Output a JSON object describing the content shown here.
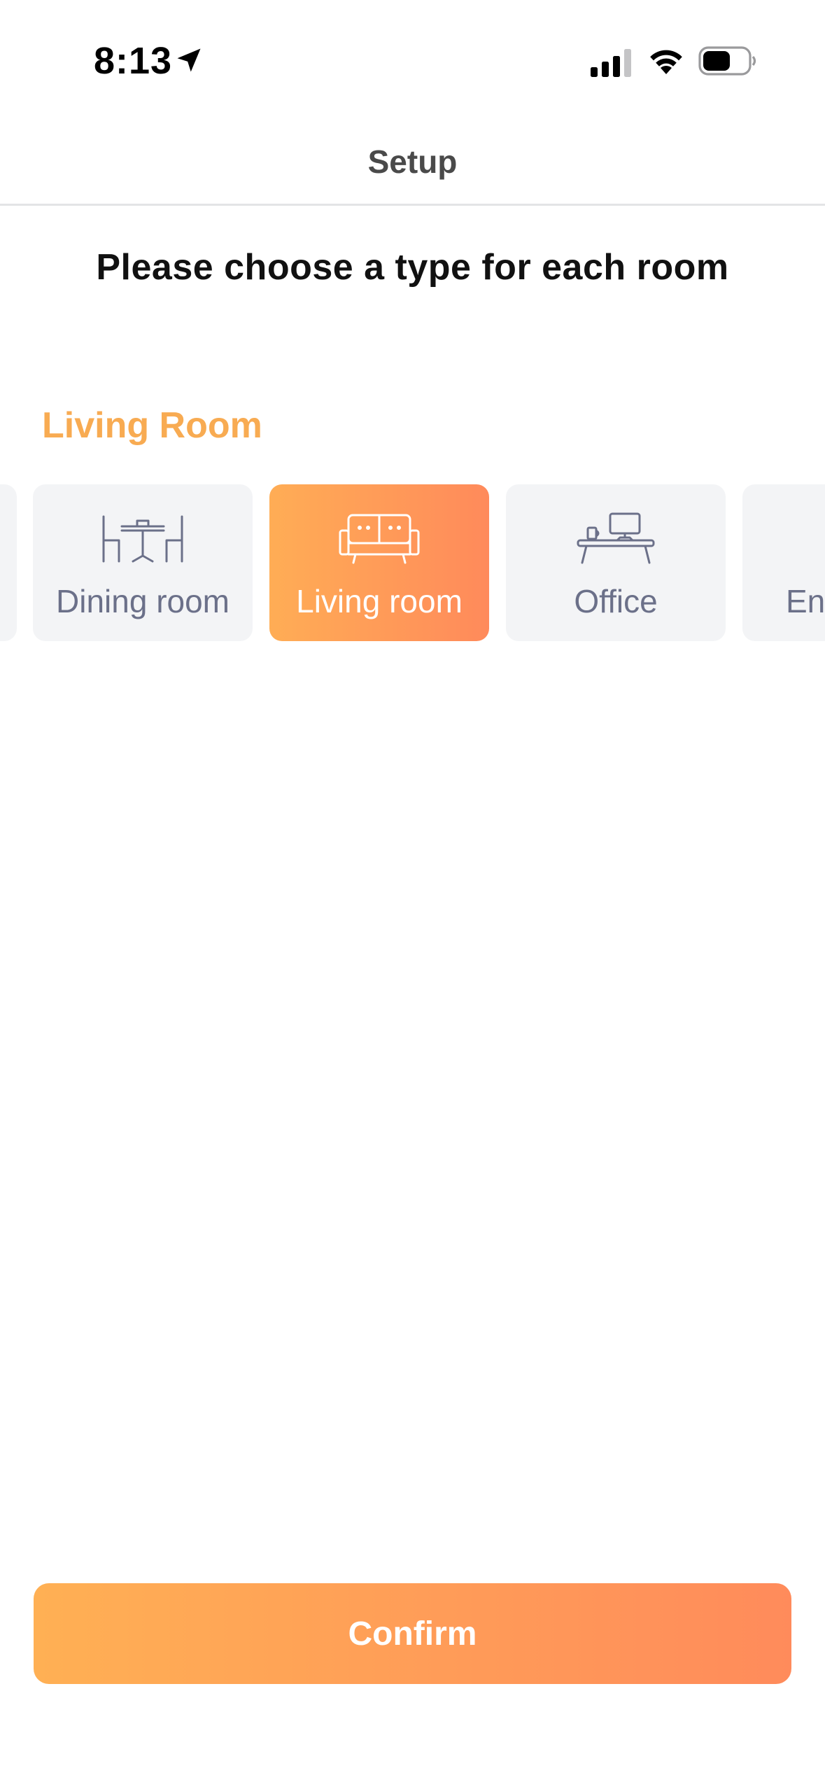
{
  "status_bar": {
    "time": "8:13",
    "icons": [
      "location-arrow-icon",
      "cellular-signal-icon",
      "wifi-icon",
      "battery-icon"
    ]
  },
  "nav": {
    "title": "Setup"
  },
  "main": {
    "heading": "Please choose a type for each room",
    "room_name": "Living Room",
    "room_types": [
      {
        "label": "",
        "icon": "room-type-icon",
        "selected": false
      },
      {
        "label": "Dining room",
        "icon": "dining-table-icon",
        "selected": false
      },
      {
        "label": "Living room",
        "icon": "sofa-icon",
        "selected": true
      },
      {
        "label": "Office",
        "icon": "desk-computer-icon",
        "selected": false
      },
      {
        "label": "Ent",
        "icon": "room-type-icon",
        "selected": false
      }
    ]
  },
  "footer": {
    "confirm_label": "Confirm"
  },
  "colors": {
    "accent_start": "#ffad55",
    "accent_end": "#ff8a5b",
    "room_name": "#f8ab52",
    "card_bg": "#f3f4f6",
    "card_text": "#6b7089"
  }
}
